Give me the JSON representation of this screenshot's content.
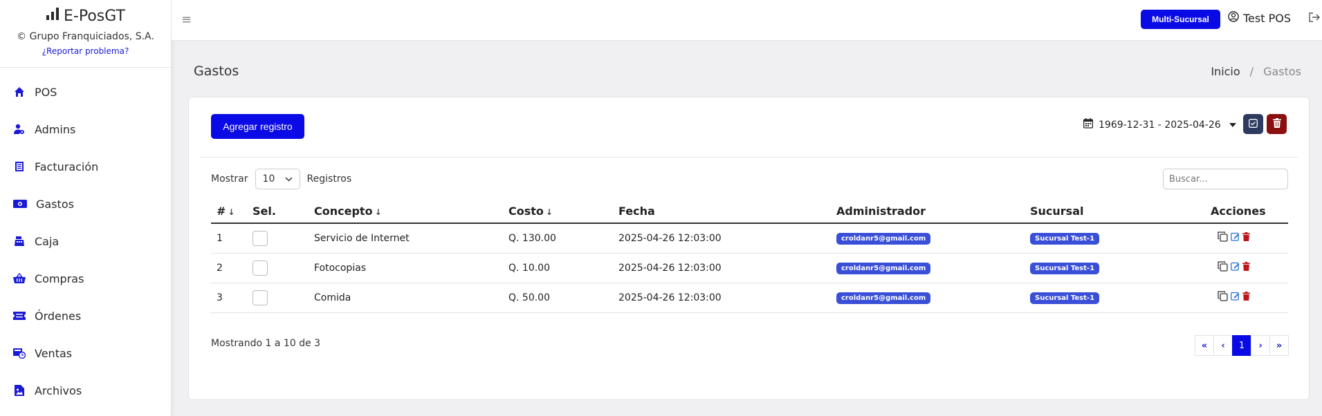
{
  "brand": {
    "title": "E-PosGT",
    "copyright": "© Grupo Franquiciados, S.A.",
    "report_link": "¿Reportar problema?"
  },
  "sidebar": {
    "items": [
      {
        "label": "POS",
        "icon": "home-icon"
      },
      {
        "label": "Admins",
        "icon": "user-gear-icon"
      },
      {
        "label": "Facturación",
        "icon": "invoice-icon"
      },
      {
        "label": "Gastos",
        "icon": "money-icon"
      },
      {
        "label": "Caja",
        "icon": "cash-register-icon"
      },
      {
        "label": "Compras",
        "icon": "basket-icon"
      },
      {
        "label": "Órdenes",
        "icon": "ticket-icon"
      },
      {
        "label": "Ventas",
        "icon": "sales-icon"
      },
      {
        "label": "Archivos",
        "icon": "image-file-icon"
      }
    ]
  },
  "topbar": {
    "multi_label": "Multi-Sucursal",
    "user_name": "Test POS"
  },
  "page": {
    "title": "Gastos",
    "breadcrumb": [
      "Inicio",
      "/",
      "Gastos"
    ]
  },
  "toolbar": {
    "add_label": "Agregar registro",
    "date_range": "1969-12-31 - 2025-04-26"
  },
  "table_controls": {
    "show_label": "Mostrar",
    "page_length": "10",
    "records_label": "Registros",
    "search_placeholder": "Buscar..."
  },
  "table": {
    "headers": [
      "#",
      "Sel.",
      "Concepto",
      "Costo",
      "Fecha",
      "Administrador",
      "Sucursal",
      "Acciones"
    ],
    "rows": [
      {
        "num": "1",
        "concepto": "Servicio de Internet",
        "costo": "Q. 130.00",
        "fecha": "2025-04-26 12:03:00",
        "admin": "croldanr5@gmail.com",
        "sucursal": "Sucursal Test-1"
      },
      {
        "num": "2",
        "concepto": "Fotocopias",
        "costo": "Q. 10.00",
        "fecha": "2025-04-26 12:03:00",
        "admin": "croldanr5@gmail.com",
        "sucursal": "Sucursal Test-1"
      },
      {
        "num": "3",
        "concepto": "Comida",
        "costo": "Q. 50.00",
        "fecha": "2025-04-26 12:03:00",
        "admin": "croldanr5@gmail.com",
        "sucursal": "Sucursal Test-1"
      }
    ]
  },
  "footer": {
    "info": "Mostrando 1 a 10 de 3",
    "current_page": "1"
  },
  "colors": {
    "primary": "#0a0ae6",
    "badge": "#3a4fd8",
    "danger": "#8a0f0f",
    "dark": "#2e3b5e"
  }
}
